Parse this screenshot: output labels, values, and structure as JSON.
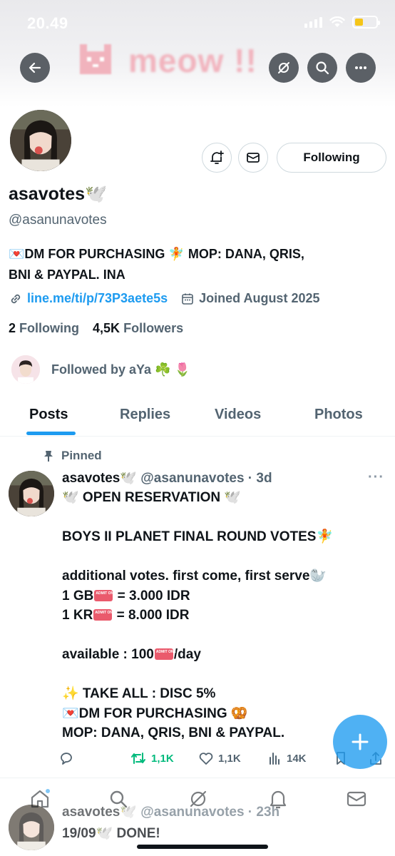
{
  "status": {
    "time": "20.49"
  },
  "banner": {
    "title": "meow !!"
  },
  "profile": {
    "name": "asavotes",
    "name_emoji": "🕊️",
    "handle": "@asanunavotes",
    "bio_line1": "💌DM FOR PURCHASING 🧚 MOP: DANA, QRIS,",
    "bio_line2": "BNI & PAYPAL. INA",
    "link": "line.me/ti/p/73P3aete5s",
    "joined": "Joined August 2025",
    "following_count": "2",
    "following_label": "Following",
    "followers_count": "4,5K",
    "followers_label": "Followers",
    "followed_by": "Followed by aYa ☘️ 🌷",
    "follow_button": "Following"
  },
  "tabs": [
    {
      "label": "Posts"
    },
    {
      "label": "Replies"
    },
    {
      "label": "Videos"
    },
    {
      "label": "Photos"
    }
  ],
  "post": {
    "pinned_label": "Pinned",
    "name": "asavotes🕊️",
    "handle_time": "@asanunavotes · 3d",
    "more": "···",
    "lines": {
      "l1": "🕊️ OPEN RESERVATION 🕊️",
      "l2": "BOYS II PLANET FINAL ROUND VOTES🧚",
      "l3": "additional votes. first come, first serve🦭",
      "l4a": "1 GB",
      "l4b": " = 3.000 IDR",
      "l5a": "1 KR",
      "l5b": " = 8.000 IDR",
      "l6a": "available : 100",
      "l6b": "/day",
      "l7": "✨ TAKE ALL : DISC 5%",
      "l8": "💌DM FOR PURCHASING 🥨",
      "l9": "MOP: DANA, QRIS, BNI & PAYPAL."
    },
    "retweets": "1,1K",
    "likes": "1,1K",
    "views": "14K"
  },
  "post2": {
    "name": "asavotes🕊️",
    "handle_time": "@asanunavotes · 23h",
    "body": "19/09🕊️ DONE!"
  },
  "colors": {
    "accent": "#1d9bf0",
    "retweet": "#00ba7c",
    "muted": "#536471"
  }
}
